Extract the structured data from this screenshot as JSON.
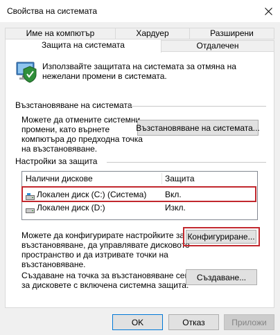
{
  "window": {
    "title": "Свойства на системата",
    "close_icon": "close-icon"
  },
  "tabs": {
    "row1": [
      "Име на компютър",
      "Хардуер",
      "Разширени"
    ],
    "row2": [
      "Защита на системата",
      "Отдалечен"
    ],
    "active": "Защита на системата"
  },
  "intro": {
    "icon": "system-protection-shield-icon",
    "line1": "Използвайте защитата на системата за отмяна на",
    "line2": "нежелани промени в системата."
  },
  "restore": {
    "heading": "Възстановяване на системата",
    "line1": "Можете да отмените системни",
    "line2": "промени, като върнете",
    "line3": "компютъра до предходна точка",
    "line4": "на възстановяване.",
    "button": "Възстановяване на системата..."
  },
  "protection": {
    "heading": "Настройки за защита",
    "col_drives": "Налични дискове",
    "col_protection": "Защита",
    "rows": [
      {
        "drive": "Локален диск (C:) (Система)",
        "protection": "Вкл.",
        "icon": "system-drive-icon",
        "highlighted": true
      },
      {
        "drive": "Локален диск (D:)",
        "protection": "Изкл.",
        "icon": "local-drive-icon",
        "highlighted": false
      }
    ],
    "configure_line1": "Можете да конфигурирате настройките за",
    "configure_line2": "възстановяване, да управлявате дисковото",
    "configure_line3": "пространство и да изтривате точки на",
    "configure_line4": "възстановяване.",
    "configure_button": "Конфигуриране...",
    "create_line1": "Създаване на точка за възстановяване сега",
    "create_line2": "за дисковете с включена системна защита.",
    "create_button": "Създаване..."
  },
  "footer": {
    "ok": "OK",
    "cancel": "Отказ",
    "apply": "Приложи"
  },
  "colors": {
    "highlight": "#c1272d",
    "accent": "#0078d7"
  }
}
